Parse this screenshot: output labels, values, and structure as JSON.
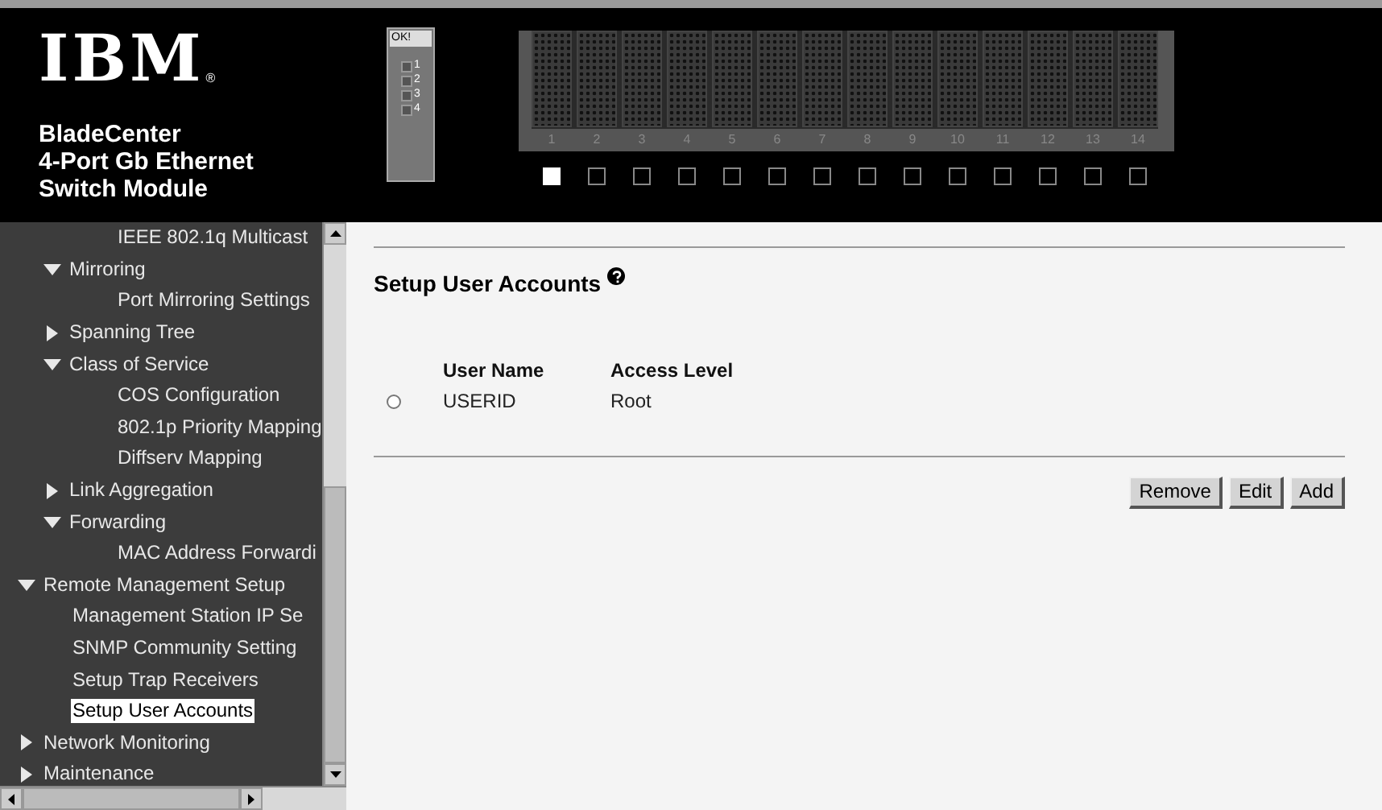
{
  "header": {
    "logo": "IBM",
    "registered": "®",
    "product": [
      "BladeCenter",
      "4-Port Gb Ethernet",
      "Switch Module"
    ],
    "module": {
      "status": "OK!",
      "ports": [
        "1",
        "2",
        "3",
        "4"
      ]
    },
    "bays": [
      {
        "label": "1",
        "selected": true
      },
      {
        "label": "2",
        "selected": false
      },
      {
        "label": "3",
        "selected": false
      },
      {
        "label": "4",
        "selected": false
      },
      {
        "label": "5",
        "selected": false
      },
      {
        "label": "6",
        "selected": false
      },
      {
        "label": "7",
        "selected": false
      },
      {
        "label": "8",
        "selected": false
      },
      {
        "label": "9",
        "selected": false
      },
      {
        "label": "10",
        "selected": false
      },
      {
        "label": "11",
        "selected": false
      },
      {
        "label": "12",
        "selected": false
      },
      {
        "label": "13",
        "selected": false
      },
      {
        "label": "14",
        "selected": false
      }
    ]
  },
  "sidebar": {
    "tree": [
      {
        "children": [
          {
            "children": [
              {
                "label": "IEEE 802.1q Multicast",
                "selected": false
              }
            ]
          },
          {
            "label": "Mirroring",
            "expanded": true,
            "children": [
              {
                "label": "Port Mirroring Settings",
                "selected": false
              }
            ]
          },
          {
            "label": "Spanning Tree",
            "expanded": false
          },
          {
            "label": "Class of Service",
            "expanded": true,
            "children": [
              {
                "label": "COS Configuration",
                "selected": false
              },
              {
                "label": "802.1p Priority Mapping",
                "selected": false
              },
              {
                "label": "Diffserv Mapping",
                "selected": false
              }
            ]
          },
          {
            "label": "Link Aggregation",
            "expanded": false
          },
          {
            "label": "Forwarding",
            "expanded": true,
            "children": [
              {
                "label": "MAC Address Forwardi",
                "selected": false
              }
            ]
          }
        ]
      },
      {
        "label": "Remote Management Setup",
        "expanded": true,
        "children": [
          {
            "label": "Management Station IP Se",
            "selected": false
          },
          {
            "label": "SNMP Community Setting",
            "selected": false
          },
          {
            "label": "Setup Trap Receivers",
            "selected": false
          },
          {
            "label": "Setup User Accounts",
            "selected": true
          }
        ]
      },
      {
        "label": "Network Monitoring",
        "expanded": false
      },
      {
        "label": "Maintenance",
        "expanded": false
      }
    ]
  },
  "main": {
    "title": "Setup User Accounts",
    "table": {
      "columns": [
        "User Name",
        "Access Level"
      ],
      "rows": [
        {
          "selected": false,
          "cells": [
            "USERID",
            "Root"
          ]
        }
      ]
    },
    "buttons": [
      "Remove",
      "Edit",
      "Add"
    ]
  }
}
